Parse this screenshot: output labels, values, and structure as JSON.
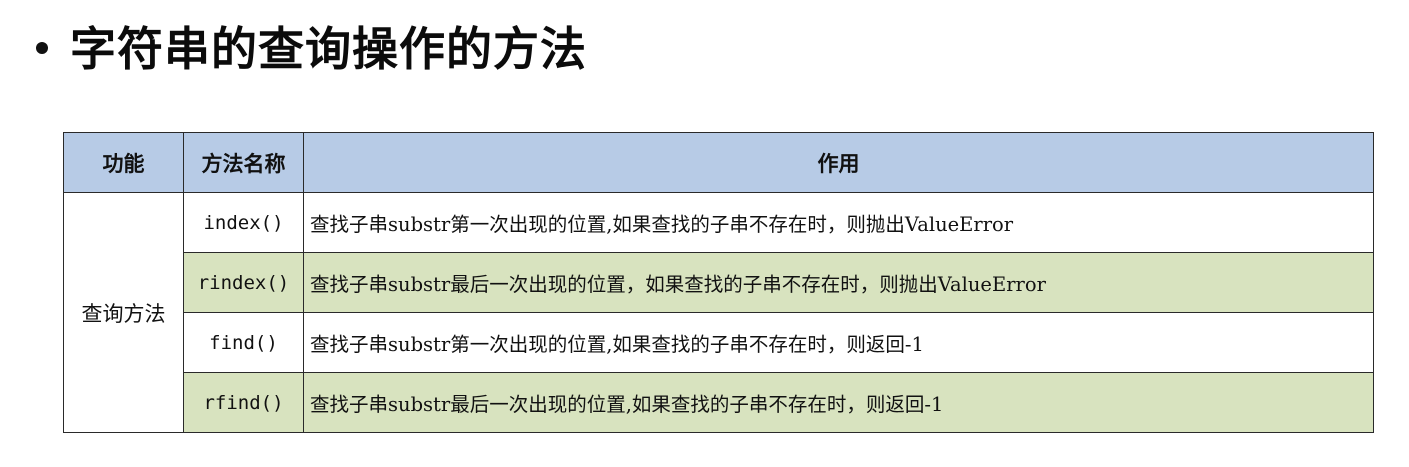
{
  "slide": {
    "title": "字符串的查询操作的方法"
  },
  "table": {
    "headers": {
      "function": "功能",
      "method_name": "方法名称",
      "effect": "作用"
    },
    "group_label": "查询方法",
    "rows": [
      {
        "method": "index()",
        "description": "查找子串substr第一次出现的位置,如果查找的子串不存在时，则抛出ValueError",
        "row_color": "#ffffff"
      },
      {
        "method": "rindex()",
        "description": "查找子串substr最后一次出现的位置，如果查找的子串不存在时，则抛出ValueError",
        "row_color": "#d8e3bf"
      },
      {
        "method": "find()",
        "description": "查找子串substr第一次出现的位置,如果查找的子串不存在时，则返回-1",
        "row_color": "#ffffff"
      },
      {
        "method": "rfind()",
        "description": "查找子串substr最后一次出现的位置,如果查找的子串不存在时，则返回-1",
        "row_color": "#d8e3bf"
      }
    ],
    "header_color": "#b7cbe6"
  }
}
